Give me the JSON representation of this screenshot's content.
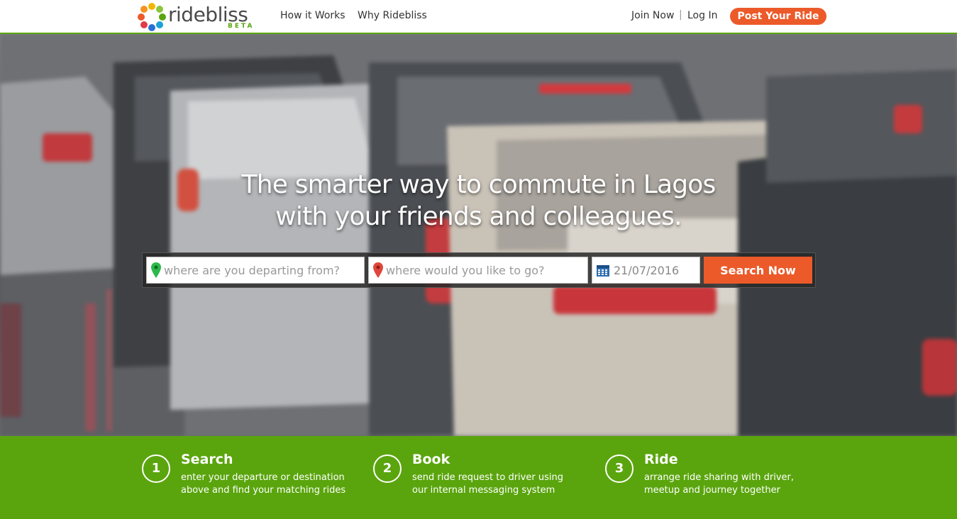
{
  "colors": {
    "brand_green": "#5aa50d",
    "accent_orange": "#ec5a2a",
    "header_bg": "#ffffff",
    "text_dark": "#333333"
  },
  "header": {
    "logo_text": "ridebliss",
    "logo_badge": "BETA",
    "logo_icon": "ridebliss-ring-logo-icon",
    "nav": [
      {
        "label": "How it Works"
      },
      {
        "label": "Why Ridebliss"
      }
    ],
    "join_label": "Join Now",
    "separator": "|",
    "login_label": "Log In",
    "post_ride_label": "Post Your Ride"
  },
  "hero": {
    "title_line1": "The smarter way to commute in Lagos",
    "title_line2": "with your friends and colleagues.",
    "search": {
      "from_placeholder": "where are you departing from?",
      "from_icon": "green-map-pin-icon",
      "to_placeholder": "where would you like to go?",
      "to_icon": "red-map-pin-icon",
      "date_value": "21/07/2016",
      "date_icon": "calendar-icon",
      "button_label": "Search Now"
    }
  },
  "steps": [
    {
      "number": "1",
      "title": "Search",
      "desc_line1": "enter your departure or destination",
      "desc_line2": "above and find your matching rides"
    },
    {
      "number": "2",
      "title": "Book",
      "desc_line1": "send ride request to driver using",
      "desc_line2": "our internal messaging system"
    },
    {
      "number": "3",
      "title": "Ride",
      "desc_line1": "arrange ride sharing with driver,",
      "desc_line2": "meetup and journey together"
    }
  ]
}
